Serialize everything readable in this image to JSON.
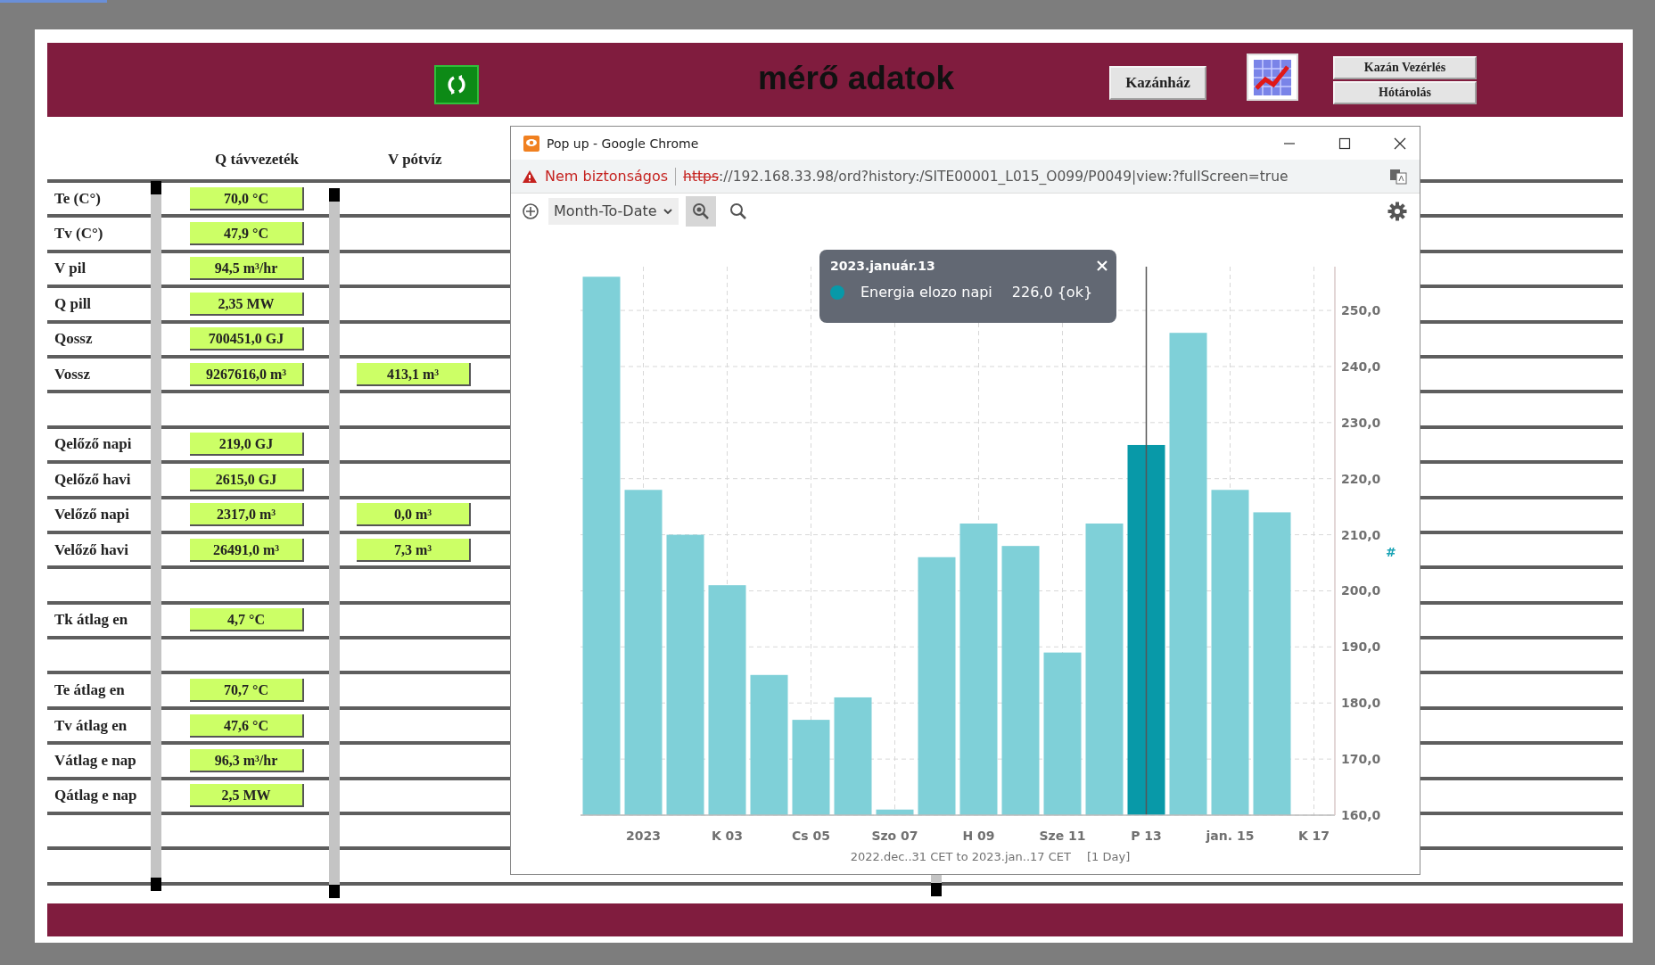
{
  "header": {
    "title": "mérő adatok",
    "main_button": "Kazánház",
    "side_buttons": [
      "Kazán Vezérlés",
      "Hótárolás"
    ]
  },
  "table": {
    "columns": [
      "Q távvezeték",
      "V pótvíz"
    ],
    "rows": [
      {
        "kind": "data",
        "label": "Te (C°)",
        "q": "70,0 °C"
      },
      {
        "kind": "data",
        "label": "Tv (C°)",
        "q": "47,9 °C"
      },
      {
        "kind": "data",
        "label": "V pil",
        "q": "94,5 m³/hr"
      },
      {
        "kind": "data",
        "label": "Q pill",
        "q": "2,35 MW"
      },
      {
        "kind": "data",
        "label": "Qossz",
        "q": "700451,0 GJ"
      },
      {
        "kind": "data",
        "label": "Vossz",
        "q": "9267616,0 m³",
        "v": "413,1 m³"
      },
      {
        "kind": "spacer"
      },
      {
        "kind": "data",
        "label": "Qelőző napi",
        "q": "219,0 GJ"
      },
      {
        "kind": "data",
        "label": "Qelőző havi",
        "q": "2615,0 GJ"
      },
      {
        "kind": "data",
        "label": "Velőző napi",
        "q": "2317,0 m³",
        "v": "0,0 m³"
      },
      {
        "kind": "data",
        "label": "Velőző havi",
        "q": "26491,0 m³",
        "v": "7,3 m³"
      },
      {
        "kind": "spacer"
      },
      {
        "kind": "data",
        "label": "Tk átlag en",
        "q": "4,7 °C"
      },
      {
        "kind": "spacer"
      },
      {
        "kind": "data",
        "label": "Te átlag en",
        "q": "70,7 °C"
      },
      {
        "kind": "data",
        "label": "Tv átlag en",
        "q": "47,6 °C"
      },
      {
        "kind": "data",
        "label": "Vátlag e nap",
        "q": "96,3 m³/hr"
      },
      {
        "kind": "data",
        "label": "Qátlag e nap",
        "q": "2,5 MW"
      },
      {
        "kind": "spacer"
      },
      {
        "kind": "spacer"
      }
    ]
  },
  "popup": {
    "title": "Pop up - Google Chrome",
    "security": "Nem biztonságos",
    "url_scheme": "https",
    "url_rest": "://192.168.33.98/ord?history:/SITE00001_L015_O099/P0049|view:?fullScreen=true",
    "range_select": "Month-To-Date",
    "interval": "[1 Day]",
    "axis_marker": "#",
    "tooltip": {
      "title": "2023.január.13",
      "value": "226,0 {ok}"
    },
    "chart_data": {
      "type": "bar",
      "xlabel": "2022.dec..31 CET to 2023.jan..17 CET",
      "categories": [
        null,
        "2023",
        null,
        "K 03",
        null,
        "Cs 05",
        null,
        "Szo 07",
        null,
        "H 09",
        null,
        "Sze 11",
        null,
        "P 13",
        null,
        "jan. 15",
        null,
        "K 17"
      ],
      "series": [
        {
          "color": "#7fd0d8",
          "values": [
            256,
            218,
            210,
            201,
            185,
            177,
            181,
            161,
            206,
            212,
            208,
            189,
            212,
            null,
            246,
            218,
            214,
            null
          ]
        },
        {
          "name": "Energia elozo napi",
          "color": "#0899a8",
          "values": [
            null,
            null,
            null,
            null,
            null,
            null,
            null,
            null,
            null,
            null,
            null,
            null,
            null,
            226,
            null,
            null,
            null,
            null
          ]
        }
      ],
      "ylim": [
        160,
        257.8
      ],
      "grid": true,
      "yticks": [
        {
          "value": 160,
          "label": "160,0"
        },
        {
          "value": 170,
          "label": "170,0"
        },
        {
          "value": 180,
          "label": "180,0"
        },
        {
          "value": 190,
          "label": "190,0"
        },
        {
          "value": 200,
          "label": "200,0"
        },
        {
          "value": 210,
          "label": "210,0"
        },
        {
          "value": 220,
          "label": "220,0"
        },
        {
          "value": 230,
          "label": "230,0"
        },
        {
          "value": 240,
          "label": "240,0"
        },
        {
          "value": 250,
          "label": "250,0"
        }
      ]
    }
  }
}
